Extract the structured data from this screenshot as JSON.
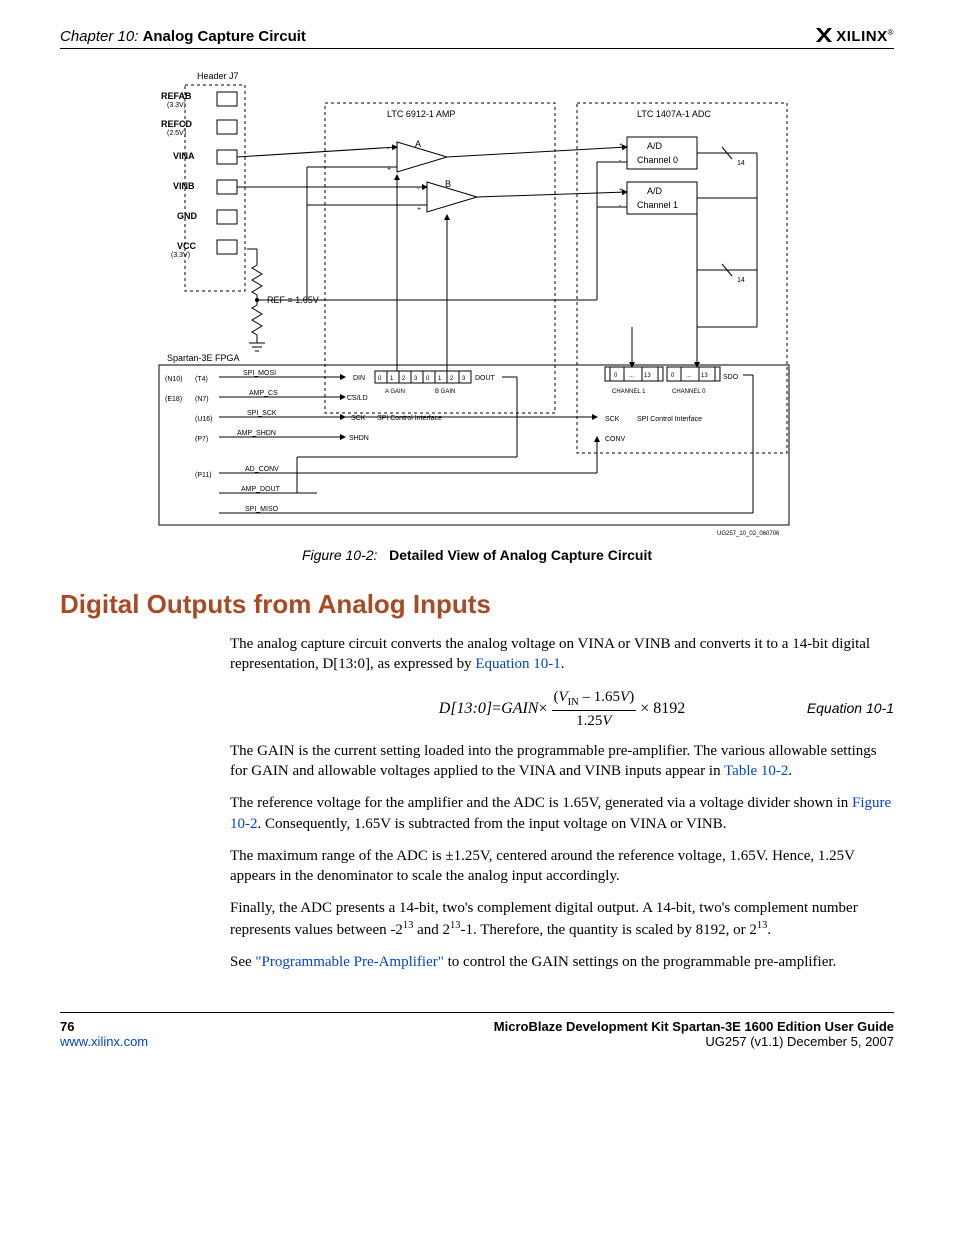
{
  "header": {
    "chapter": "Chapter 10:",
    "chapter_title": "Analog Capture Circuit",
    "logo_text": "XILINX",
    "logo_reg": "®"
  },
  "figure": {
    "id": "UG257_10_02_060706",
    "caption_label": "Figure 10-2:",
    "caption_text": "Detailed View of Analog Capture Circuit",
    "labels": {
      "header_j7": "Header J7",
      "refab": "REFAB",
      "refab_v": "(3.3V)",
      "refcd": "REFCD",
      "refcd_v": "(2.5V)",
      "vina": "VINA",
      "vinb": "VINB",
      "gnd": "GND",
      "vcc": "VCC",
      "vcc_v": "(3.3V)",
      "ref_165": "REF = 1.65V",
      "fpga": "Spartan-3E FPGA",
      "ltc_amp": "LTC 6912-1 AMP",
      "ltc_adc": "LTC 1407A-1 ADC",
      "amp_a": "A",
      "amp_b": "B",
      "ad_ch0": "A/D",
      "ch0": "Channel 0",
      "ad_ch1": "A/D",
      "ch1": "Channel 1",
      "b14": "14",
      "spi_mosi": "SPI_MOSI",
      "amp_cs": "AMP_CS",
      "spi_sck": "SPI_SCK",
      "amp_shdn": "AMP_SHDN",
      "ad_conv": "AD_CONV",
      "amp_dout": "AMP_DOUT",
      "spi_miso": "SPI_MISO",
      "n10": "(N10)",
      "t4": "(T4)",
      "e18": "(E18)",
      "n7": "(N7)",
      "u16": "(U16)",
      "p7": "(P7)",
      "p11": "(P11)",
      "din": "DIN",
      "dout": "DOUT",
      "csld": "CS/LD",
      "sck": "SCK",
      "shdn": "SHDN",
      "conv": "CONV",
      "sdo": "SDO",
      "again": "A GAIN",
      "bgain": "B GAIN",
      "spi_ctrl": "SPI Control Interface",
      "ch1_lbl": "CHANNEL 1",
      "ch0_lbl": "CHANNEL 0",
      "b0": "0",
      "b1": "1",
      "b2": "2",
      "b3": "3",
      "b13": "13",
      "dots": "..."
    }
  },
  "section_heading": "Digital Outputs from Analog Inputs",
  "body": {
    "p1a": "The analog capture circuit converts the analog voltage on VINA or VINB and converts it to a 14-bit digital representation, D[13:0], as expressed by ",
    "p1_link": "Equation 10-1",
    "p1b": ".",
    "eq_lhs": "D[13:0]",
    "eq_eq": " = ",
    "eq_gain": "GAIN",
    "eq_mul": " × ",
    "eq_num_a": "(V",
    "eq_num_sub": "IN",
    "eq_num_b": " – 1.65V)",
    "eq_den": "1.25V",
    "eq_tail": " × 8192",
    "eq_label": "Equation 10-1",
    "p2a": "The GAIN is the current setting loaded into the programmable pre-amplifier. The various allowable settings for GAIN and allowable voltages applied to the VINA and VINB inputs appear in ",
    "p2_link": "Table 10-2",
    "p2b": ".",
    "p3a": "The reference voltage for the amplifier and the ADC is 1.65V, generated via a voltage divider shown in ",
    "p3_link": "Figure 10-2",
    "p3b": ". Consequently, 1.65V is subtracted from the input voltage on VINA or VINB.",
    "p4": "The maximum range of the ADC is ±1.25V, centered around the reference voltage, 1.65V. Hence, 1.25V appears in the denominator to scale the analog input accordingly.",
    "p5a": "Finally, the ADC presents a 14-bit, two's complement digital output. A 14-bit, two's complement number represents values between -2",
    "p5_sup1": "13",
    "p5b": " and 2",
    "p5_sup2": "13",
    "p5c": "-1. Therefore, the quantity is scaled by 8192, or 2",
    "p5_sup3": "13",
    "p5d": ".",
    "p6a": "See ",
    "p6_link": "\"Programmable Pre-Amplifier\"",
    "p6b": " to control the GAIN settings on the programmable pre-amplifier."
  },
  "footer": {
    "page": "76",
    "url": "www.xilinx.com",
    "doc_title": "MicroBlaze Development Kit Spartan-3E 1600 Edition User Guide",
    "doc_rev": "UG257 (v1.1) December 5, 2007"
  }
}
